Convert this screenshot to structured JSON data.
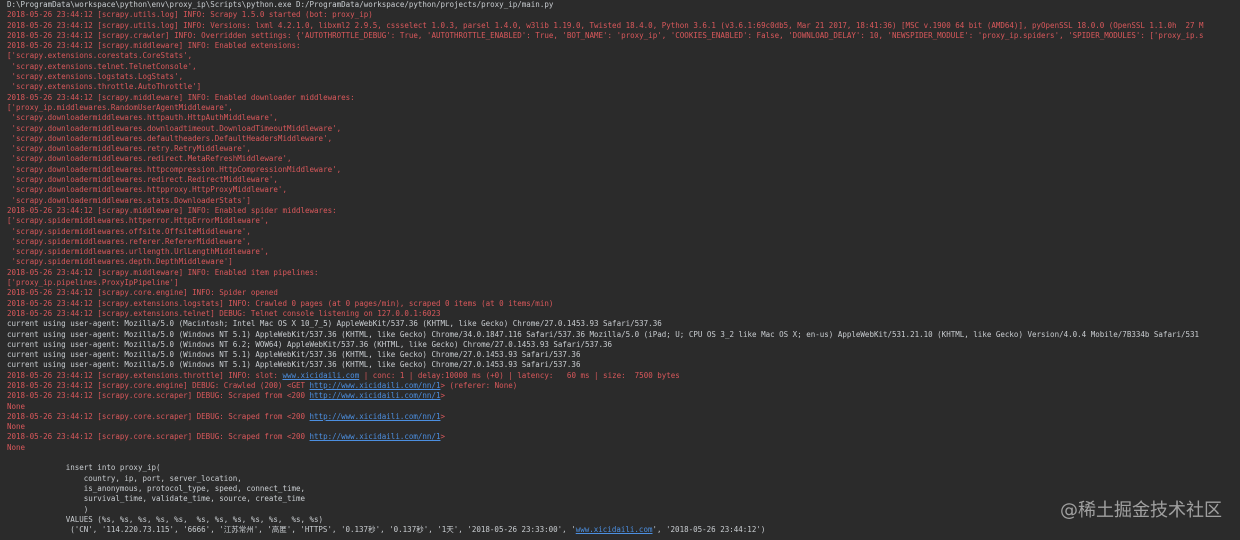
{
  "lines": [
    {
      "color": "white",
      "segs": [
        {
          "t": "D:\\ProgramData\\workspace\\python\\env\\proxy_ip\\Scripts\\python.exe D:/ProgramData/workspace/python/projects/proxy_ip/main.py"
        }
      ]
    },
    {
      "color": "red",
      "segs": [
        {
          "t": "2018-05-26 23:44:12 [scrapy.utils.log] INFO: Scrapy 1.5.0 started (bot: proxy_ip)"
        }
      ]
    },
    {
      "color": "red",
      "segs": [
        {
          "t": "2018-05-26 23:44:12 [scrapy.utils.log] INFO: Versions: lxml 4.2.1.0, libxml2 2.9.5, cssselect 1.0.3, parsel 1.4.0, w3lib 1.19.0, Twisted 18.4.0, Python 3.6.1 (v3.6.1:69c0db5, Mar 21 2017, 18:41:36) [MSC v.1900 64 bit (AMD64)], pyOpenSSL 18.0.0 (OpenSSL 1.1.0h  27 M"
        }
      ]
    },
    {
      "color": "red",
      "segs": [
        {
          "t": "2018-05-26 23:44:12 [scrapy.crawler] INFO: Overridden settings: {'AUTOTHROTTLE_DEBUG': True, 'AUTOTHROTTLE_ENABLED': True, 'BOT_NAME': 'proxy_ip', 'COOKIES_ENABLED': False, 'DOWNLOAD_DELAY': 10, 'NEWSPIDER_MODULE': 'proxy_ip.spiders', 'SPIDER_MODULES': ['proxy_ip.s"
        }
      ]
    },
    {
      "color": "red",
      "segs": [
        {
          "t": "2018-05-26 23:44:12 [scrapy.middleware] INFO: Enabled extensions:"
        }
      ]
    },
    {
      "color": "red",
      "segs": [
        {
          "t": "['scrapy.extensions.corestats.CoreStats',"
        }
      ]
    },
    {
      "color": "red",
      "segs": [
        {
          "t": " 'scrapy.extensions.telnet.TelnetConsole',"
        }
      ]
    },
    {
      "color": "red",
      "segs": [
        {
          "t": " 'scrapy.extensions.logstats.LogStats',"
        }
      ]
    },
    {
      "color": "red",
      "segs": [
        {
          "t": " 'scrapy.extensions.throttle.AutoThrottle']"
        }
      ]
    },
    {
      "color": "red",
      "segs": [
        {
          "t": "2018-05-26 23:44:12 [scrapy.middleware] INFO: Enabled downloader middlewares:"
        }
      ]
    },
    {
      "color": "red",
      "segs": [
        {
          "t": "['proxy_ip.middlewares.RandomUserAgentMiddleware',"
        }
      ]
    },
    {
      "color": "red",
      "segs": [
        {
          "t": " 'scrapy.downloadermiddlewares.httpauth.HttpAuthMiddleware',"
        }
      ]
    },
    {
      "color": "red",
      "segs": [
        {
          "t": " 'scrapy.downloadermiddlewares.downloadtimeout.DownloadTimeoutMiddleware',"
        }
      ]
    },
    {
      "color": "red",
      "segs": [
        {
          "t": " 'scrapy.downloadermiddlewares.defaultheaders.DefaultHeadersMiddleware',"
        }
      ]
    },
    {
      "color": "red",
      "segs": [
        {
          "t": " 'scrapy.downloadermiddlewares.retry.RetryMiddleware',"
        }
      ]
    },
    {
      "color": "red",
      "segs": [
        {
          "t": " 'scrapy.downloadermiddlewares.redirect.MetaRefreshMiddleware',"
        }
      ]
    },
    {
      "color": "red",
      "segs": [
        {
          "t": " 'scrapy.downloadermiddlewares.httpcompression.HttpCompressionMiddleware',"
        }
      ]
    },
    {
      "color": "red",
      "segs": [
        {
          "t": " 'scrapy.downloadermiddlewares.redirect.RedirectMiddleware',"
        }
      ]
    },
    {
      "color": "red",
      "segs": [
        {
          "t": " 'scrapy.downloadermiddlewares.httpproxy.HttpProxyMiddleware',"
        }
      ]
    },
    {
      "color": "red",
      "segs": [
        {
          "t": " 'scrapy.downloadermiddlewares.stats.DownloaderStats']"
        }
      ]
    },
    {
      "color": "red",
      "segs": [
        {
          "t": "2018-05-26 23:44:12 [scrapy.middleware] INFO: Enabled spider middlewares:"
        }
      ]
    },
    {
      "color": "red",
      "segs": [
        {
          "t": "['scrapy.spidermiddlewares.httperror.HttpErrorMiddleware',"
        }
      ]
    },
    {
      "color": "red",
      "segs": [
        {
          "t": " 'scrapy.spidermiddlewares.offsite.OffsiteMiddleware',"
        }
      ]
    },
    {
      "color": "red",
      "segs": [
        {
          "t": " 'scrapy.spidermiddlewares.referer.RefererMiddleware',"
        }
      ]
    },
    {
      "color": "red",
      "segs": [
        {
          "t": " 'scrapy.spidermiddlewares.urllength.UrlLengthMiddleware',"
        }
      ]
    },
    {
      "color": "red",
      "segs": [
        {
          "t": " 'scrapy.spidermiddlewares.depth.DepthMiddleware']"
        }
      ]
    },
    {
      "color": "red",
      "segs": [
        {
          "t": "2018-05-26 23:44:12 [scrapy.middleware] INFO: Enabled item pipelines:"
        }
      ]
    },
    {
      "color": "red",
      "segs": [
        {
          "t": "['proxy_ip.pipelines.ProxyIpPipeline']"
        }
      ]
    },
    {
      "color": "red",
      "segs": [
        {
          "t": "2018-05-26 23:44:12 [scrapy.core.engine] INFO: Spider opened"
        }
      ]
    },
    {
      "color": "red",
      "segs": [
        {
          "t": "2018-05-26 23:44:12 [scrapy.extensions.logstats] INFO: Crawled 0 pages (at 0 pages/min), scraped 0 items (at 0 items/min)"
        }
      ]
    },
    {
      "color": "red",
      "segs": [
        {
          "t": "2018-05-26 23:44:12 [scrapy.extensions.telnet] DEBUG: Telnet console listening on 127.0.0.1:6023"
        }
      ]
    },
    {
      "color": "white",
      "segs": [
        {
          "t": "current using user-agent: Mozilla/5.0 (Macintosh; Intel Mac OS X 10_7_5) AppleWebKit/537.36 (KHTML, like Gecko) Chrome/27.0.1453.93 Safari/537.36"
        }
      ]
    },
    {
      "color": "white",
      "segs": [
        {
          "t": "current using user-agent: Mozilla/5.0 (Windows NT 5.1) AppleWebKit/537.36 (KHTML, like Gecko) Chrome/34.0.1847.116 Safari/537.36 Mozilla/5.0 (iPad; U; CPU OS 3_2 like Mac OS X; en-us) AppleWebKit/531.21.10 (KHTML, like Gecko) Version/4.0.4 Mobile/7B334b Safari/531"
        }
      ]
    },
    {
      "color": "white",
      "segs": [
        {
          "t": "current using user-agent: Mozilla/5.0 (Windows NT 6.2; WOW64) AppleWebKit/537.36 (KHTML, like Gecko) Chrome/27.0.1453.93 Safari/537.36"
        }
      ]
    },
    {
      "color": "white",
      "segs": [
        {
          "t": "current using user-agent: Mozilla/5.0 (Windows NT 5.1) AppleWebKit/537.36 (KHTML, like Gecko) Chrome/27.0.1453.93 Safari/537.36"
        }
      ]
    },
    {
      "color": "white",
      "segs": [
        {
          "t": "current using user-agent: Mozilla/5.0 (Windows NT 5.1) AppleWebKit/537.36 (KHTML, like Gecko) Chrome/27.0.1453.93 Safari/537.36"
        }
      ]
    },
    {
      "color": "red",
      "segs": [
        {
          "t": "2018-05-26 23:44:12 [scrapy.extensions.throttle] INFO: slot: "
        },
        {
          "t": "www.xicidaili.com",
          "link": true
        },
        {
          "t": " | conc: 1 | delay:10000 ms (+0) | latency:   60 ms | size:  7500 bytes"
        }
      ]
    },
    {
      "color": "red",
      "segs": [
        {
          "t": "2018-05-26 23:44:12 [scrapy.core.engine] DEBUG: Crawled (200) <GET "
        },
        {
          "t": "http://www.xicidaili.com/nn/1",
          "link": true
        },
        {
          "t": "> (referer: None)"
        }
      ]
    },
    {
      "color": "red",
      "segs": [
        {
          "t": "2018-05-26 23:44:12 [scrapy.core.scraper] DEBUG: Scraped from <200 "
        },
        {
          "t": "http://www.xicidaili.com/nn/1",
          "link": true
        },
        {
          "t": ">"
        }
      ]
    },
    {
      "color": "red",
      "segs": [
        {
          "t": "None"
        }
      ]
    },
    {
      "color": "red",
      "segs": [
        {
          "t": "2018-05-26 23:44:12 [scrapy.core.scraper] DEBUG: Scraped from <200 "
        },
        {
          "t": "http://www.xicidaili.com/nn/1",
          "link": true
        },
        {
          "t": ">"
        }
      ]
    },
    {
      "color": "red",
      "segs": [
        {
          "t": "None"
        }
      ]
    },
    {
      "color": "red",
      "segs": [
        {
          "t": "2018-05-26 23:44:12 [scrapy.core.scraper] DEBUG: Scraped from <200 "
        },
        {
          "t": "http://www.xicidaili.com/nn/1",
          "link": true
        },
        {
          "t": ">"
        }
      ]
    },
    {
      "color": "red",
      "segs": [
        {
          "t": "None"
        }
      ]
    },
    {
      "color": "white",
      "segs": [
        {
          "t": ""
        }
      ]
    },
    {
      "color": "white",
      "segs": [
        {
          "t": "             insert into proxy_ip("
        }
      ]
    },
    {
      "color": "white",
      "segs": [
        {
          "t": "                 country, ip, port, server_location,"
        }
      ]
    },
    {
      "color": "white",
      "segs": [
        {
          "t": "                 is_anonymous, protocol_type, speed, connect_time,"
        }
      ]
    },
    {
      "color": "white",
      "segs": [
        {
          "t": "                 survival_time, validate_time, source, create_time"
        }
      ]
    },
    {
      "color": "white",
      "segs": [
        {
          "t": "                 )"
        }
      ]
    },
    {
      "color": "white",
      "segs": [
        {
          "t": "             VALUES (%s, %s, %s, %s, %s,  %s, %s, %s, %s, %s,  %s, %s)"
        }
      ]
    },
    {
      "color": "white",
      "segs": [
        {
          "t": "              ('CN', '114.220.73.115', '6666', '江苏常州', '高匿', 'HTTPS', '0.137秒', '0.137秒', '1天', '2018-05-26 23:33:00', '"
        },
        {
          "t": "www.xicidaili.com",
          "link": true
        },
        {
          "t": "', '2018-05-26 23:44:12')"
        }
      ]
    }
  ],
  "watermark": "@稀土掘金技术社区"
}
